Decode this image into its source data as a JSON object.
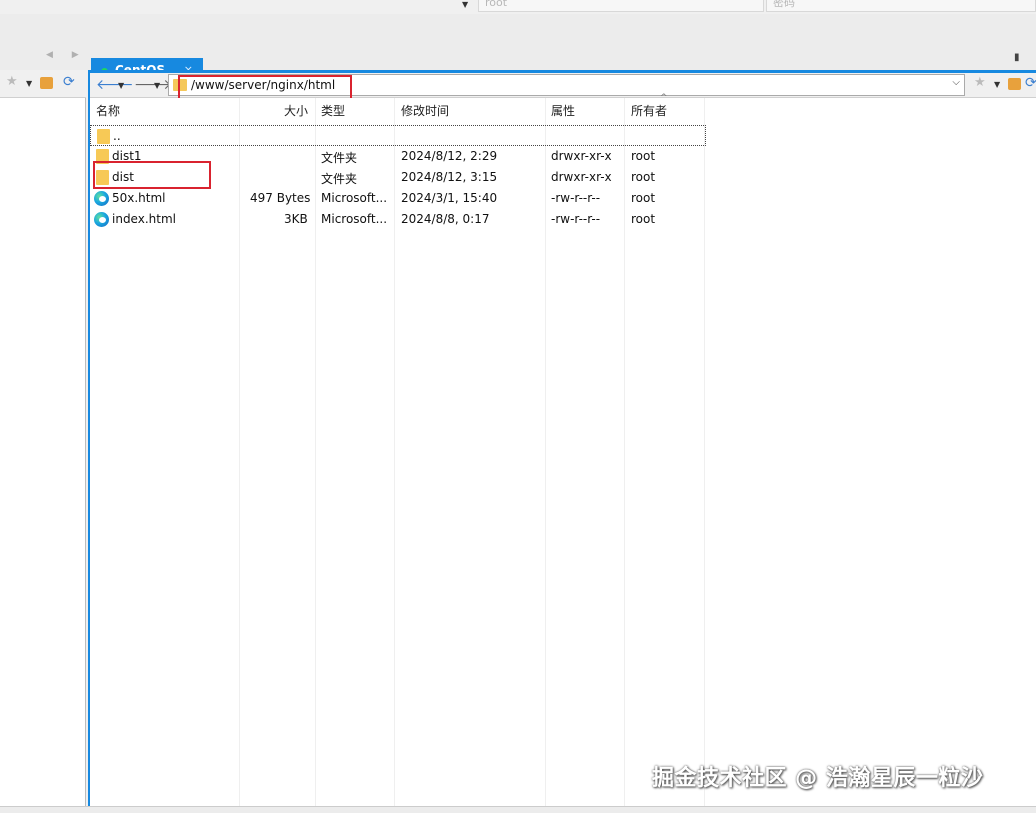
{
  "top": {
    "user_field": "root",
    "password_field": "密码"
  },
  "tab": {
    "label": "CentOS",
    "close": "×"
  },
  "toolbar": {
    "address": "/www/server/nginx/html"
  },
  "columns": {
    "name": "名称",
    "size": "大小",
    "type": "类型",
    "modified": "修改时间",
    "attrs": "属性",
    "owner": "所有者"
  },
  "files": [
    {
      "name": "..",
      "size": "",
      "type": "",
      "modified": "",
      "attrs": "",
      "owner": "",
      "icon": "folder-icon"
    },
    {
      "name": "dist1",
      "size": "",
      "type": "文件夹",
      "modified": "2024/8/12, 2:29",
      "attrs": "drwxr-xr-x",
      "owner": "root",
      "icon": "folder-icon"
    },
    {
      "name": "dist",
      "size": "",
      "type": "文件夹",
      "modified": "2024/8/12, 3:15",
      "attrs": "drwxr-xr-x",
      "owner": "root",
      "icon": "folder-icon"
    },
    {
      "name": "50x.html",
      "size": "497 Bytes",
      "type": "Microsoft...",
      "modified": "2024/3/1, 15:40",
      "attrs": "-rw-r--r--",
      "owner": "root",
      "icon": "edge-html-icon"
    },
    {
      "name": "index.html",
      "size": "3KB",
      "type": "Microsoft...",
      "modified": "2024/8/8, 0:17",
      "attrs": "-rw-r--r--",
      "owner": "root",
      "icon": "edge-html-icon"
    }
  ],
  "watermark": "掘金技术社区 @ 浩瀚星辰一粒沙",
  "colors": {
    "accent": "#1789e0",
    "highlight": "#d9232f",
    "folder": "#f7c956"
  }
}
